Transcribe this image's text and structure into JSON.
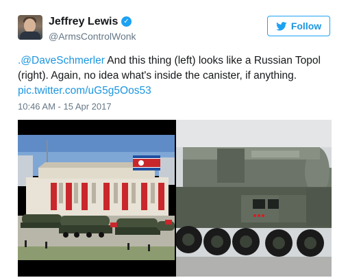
{
  "author": {
    "name": "Jeffrey Lewis",
    "handle": "@ArmsControlWonk",
    "verified": true
  },
  "follow_button": {
    "label": "Follow",
    "icon": "twitter-bird-icon"
  },
  "tweet": {
    "mention": ".@DaveSchmerler",
    "text": " And this thing (left) looks like a Russian Topol (right). Again, no idea what's inside the canister, if anything.",
    "link": "pic.twitter.com/uG5g5Oos53",
    "timestamp": "10:46 AM - 15 Apr 2017"
  },
  "colors": {
    "accent": "#1da1f2",
    "link": "#1b95e0",
    "text": "#14171a",
    "muted": "#657786"
  }
}
